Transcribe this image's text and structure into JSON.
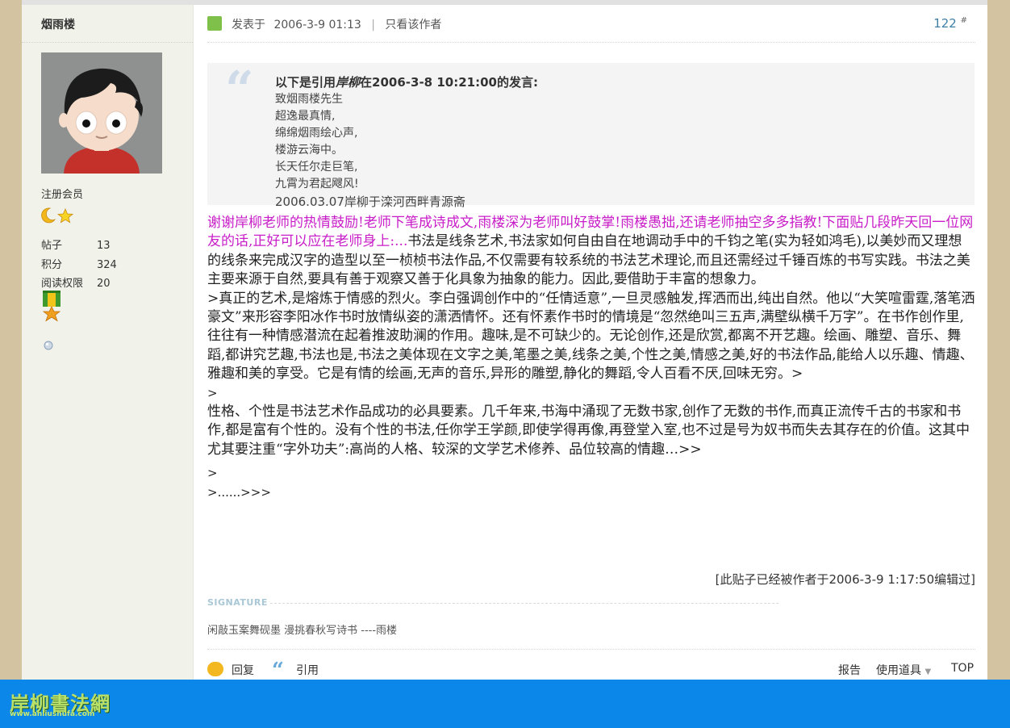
{
  "author": {
    "name": "烟雨楼",
    "group": "注册会员",
    "stats": [
      {
        "label": "帖子",
        "value": "13"
      },
      {
        "label": "积分",
        "value": "324"
      },
      {
        "label": "阅读权限",
        "value": "20"
      }
    ]
  },
  "post": {
    "posted_label": "发表于",
    "posted_time": "2006-3-9 01:13",
    "only_author": "只看该作者",
    "floor": "122",
    "floor_mark": "#"
  },
  "quote": {
    "prefix": "以下是引用",
    "quoted_author": "岸柳",
    "suffix": "在2006-3-8 10:21:00的发言:",
    "lines": [
      "致烟雨楼先生",
      "超逸最真情,",
      "绵绵烟雨绘心声,",
      "楼游云海中。",
      "长天任尔走巨笔,",
      "九霄为君起飕风!"
    ],
    "signature_line": "2006.03.07岸柳于滦河西畔青源斋"
  },
  "content": {
    "highlight": "谢谢岸柳老师的热情鼓励!老师下笔成诗成文,雨楼深为老师叫好鼓掌!雨楼愚拙,还请老师抽空多多指教!下面贴几段昨天回一位网友的话,正好可以应在老师身上:...",
    "p1": "书法是线条艺术,书法家如何自由自在地调动手中的千钧之笔(实为轻如鸿毛),以美妙而又理想的线条来完成汉字的造型以至一桢桢书法作品,不仅需要有较系统的书法艺术理论,而且还需经过千锤百炼的书写实践。书法之美主要来源于自然,要具有善于观察又善于化具象为抽象的能力。因此,要借助于丰富的想象力。",
    "p2": ">真正的艺术,是熔炼于情感的烈火。李白强调创作中的“任情适意”,一旦灵感触发,挥洒而出,纯出自然。他以“大笑喧雷霆,落笔洒豪文”来形容李阳冰作书时放情纵姿的潇洒情怀。还有怀素作书时的情境是“忽然绝叫三五声,满壁纵横千万字”。在书作创作里,往往有一种情感潜流在起着推波助澜的作用。趣味,是不可缺少的。无论创作,还是欣赏,都离不开艺趣。绘画、雕塑、音乐、舞蹈,都讲究艺趣,书法也是,书法之美体现在文字之美,笔墨之美,线条之美,个性之美,情感之美,好的书法作品,能给人以乐趣、情趣、雅趣和美的享受。它是有情的绘画,无声的音乐,异形的雕塑,静化的舞蹈,令人百看不厌,回味无穷。>",
    "gt1": ">",
    "p3": "性格、个性是书法艺术作品成功的必具要素。几千年来,书海中涌现了无数书家,创作了无数的书作,而真正流传千古的书家和书作,都是富有个性的。没有个性的书法,任你学王学颜,即使学得再像,再登堂入室,也不过是号为奴书而失去其存在的价值。这其中尤其要注重“字外功夫”:高尚的人格、较深的文学艺术修养、品位较高的情趣…>>",
    "gt2": ">",
    "gt3": ">......>>>"
  },
  "edited_note": "[此贴子已经被作者于2006-3-9 1:17:50编辑过]",
  "signature": {
    "label": "SIGNATURE",
    "text": "闲敲玉案舞砚墨 漫挑春秋写诗书 ----雨楼"
  },
  "actions": {
    "reply": "回复",
    "quote": "引用",
    "report": "报告",
    "tools": "使用道具",
    "top": "TOP"
  },
  "footer": {
    "logo": "岸柳書法網",
    "url": "www.anliushufa.com"
  },
  "colors": {
    "page_bg": "#d3c3a0",
    "sidebar_bg": "#f1f3ea",
    "highlight_text": "#c81dc8",
    "floor_link": "#3e7fa6",
    "bottom_bar": "#0a87e8"
  }
}
